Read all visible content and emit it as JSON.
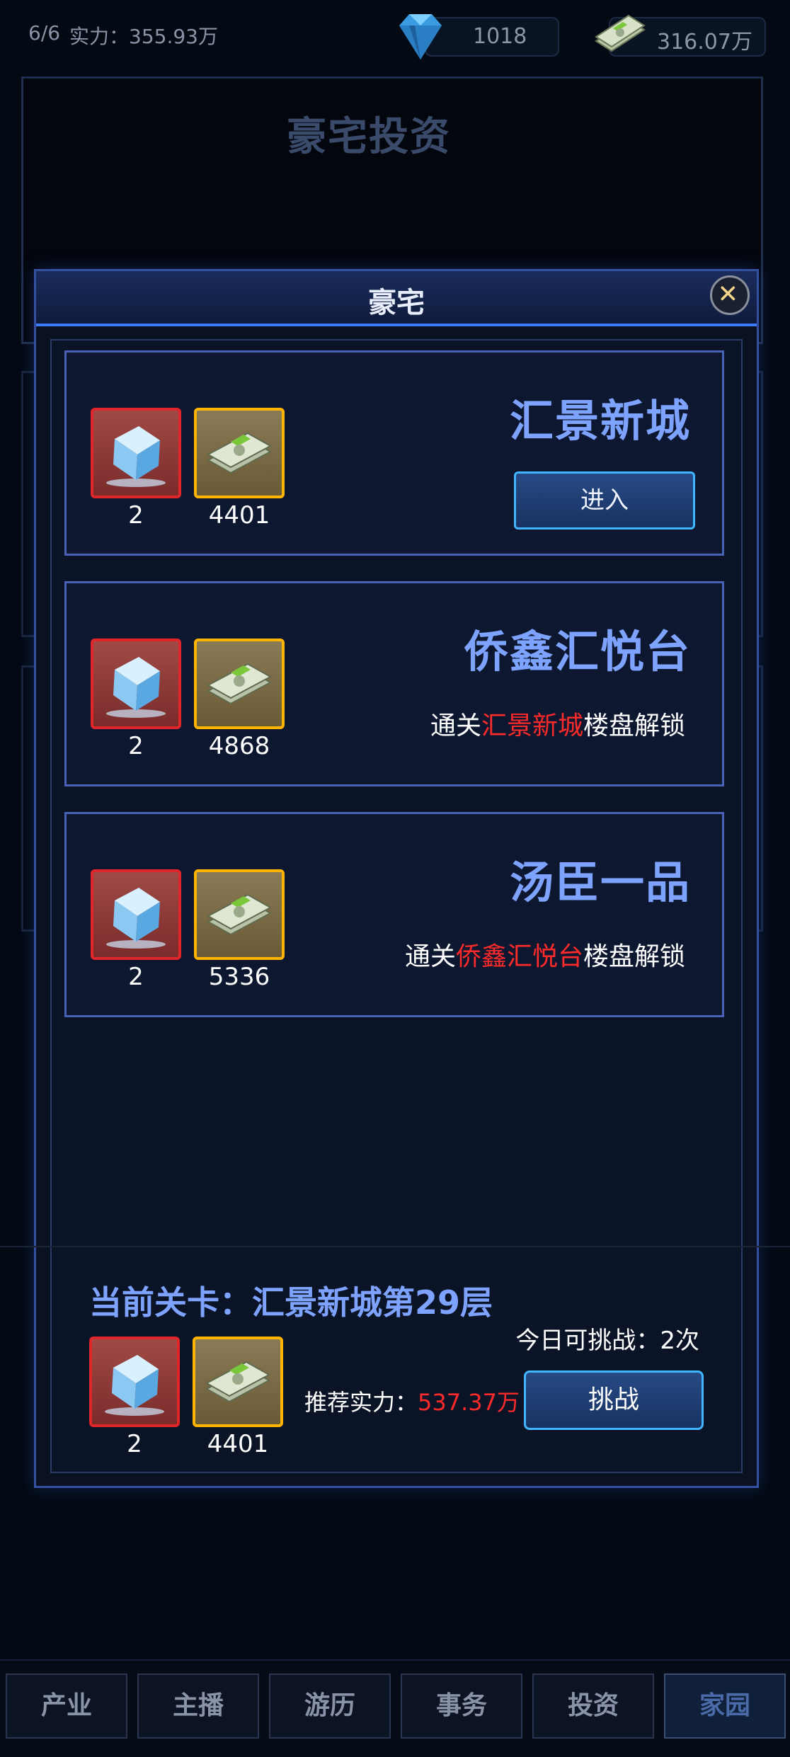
{
  "top": {
    "level": "6/6",
    "power_label": "实力：355.93万",
    "diamonds": "1018",
    "cash": "316.07万"
  },
  "background_page": {
    "title": "豪宅投资"
  },
  "modal": {
    "title": "豪宅",
    "buildings": [
      {
        "name": "汇景新城",
        "reward_ice": "2",
        "reward_cash": "4401",
        "action_label": "进入"
      },
      {
        "name": "侨鑫汇悦台",
        "reward_ice": "2",
        "reward_cash": "4868",
        "unlock_prefix": "通关",
        "unlock_target": "汇景新城",
        "unlock_suffix": "楼盘解锁"
      },
      {
        "name": "汤臣一品",
        "reward_ice": "2",
        "reward_cash": "5336",
        "unlock_prefix": "通关",
        "unlock_target": "侨鑫汇悦台",
        "unlock_suffix": "楼盘解锁"
      }
    ],
    "current_stage": {
      "title": "当前关卡：汇景新城第29层",
      "today_label": "今日可挑战：2次",
      "reward_ice": "2",
      "reward_cash": "4401",
      "recommend_label": "推荐实力：",
      "recommend_value": "537.37万",
      "challenge_label": "挑战"
    }
  },
  "bottom_nav": [
    {
      "label": "产业",
      "active": false
    },
    {
      "label": "主播",
      "active": false
    },
    {
      "label": "游历",
      "active": false
    },
    {
      "label": "事务",
      "active": false
    },
    {
      "label": "投资",
      "active": false
    },
    {
      "label": "家园",
      "active": true
    }
  ],
  "icons": [
    "diamond-icon",
    "cash-icon",
    "ice-cube-icon",
    "close-icon"
  ]
}
